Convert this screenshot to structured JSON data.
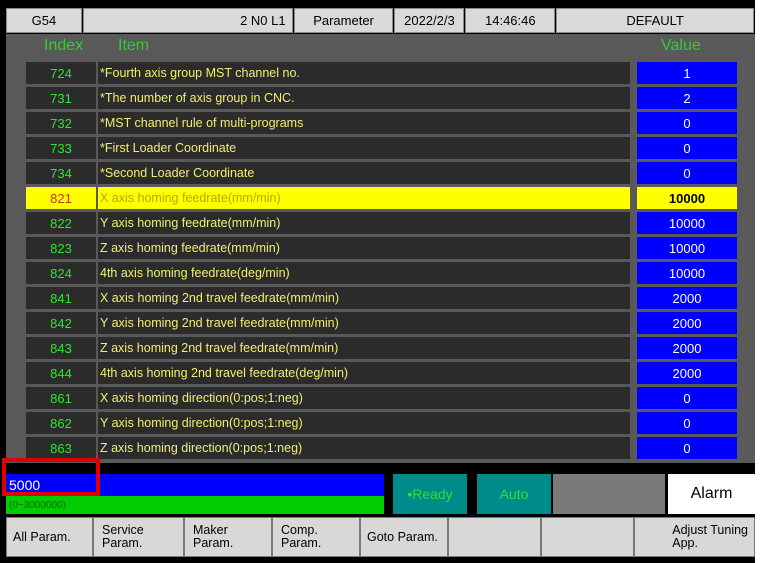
{
  "header": {
    "coord": "G54",
    "program": "2 N0 L1",
    "mode": "Parameter",
    "date": "2022/2/3",
    "time": "14:46:46",
    "profile": "DEFAULT"
  },
  "columns": {
    "index": "Index",
    "item": "Item",
    "value": "Value"
  },
  "rows": [
    {
      "index": "724",
      "item": "*Fourth axis group MST channel no.",
      "value": "1"
    },
    {
      "index": "731",
      "item": "*The number of axis group in CNC.",
      "value": "2"
    },
    {
      "index": "732",
      "item": "*MST channel rule of multi-programs",
      "value": "0"
    },
    {
      "index": "733",
      "item": "*First Loader Coordinate",
      "value": "0"
    },
    {
      "index": "734",
      "item": "*Second Loader Coordinate",
      "value": "0"
    },
    {
      "index": "821",
      "item": "X axis homing feedrate(mm/min)",
      "value": "10000",
      "selected": true
    },
    {
      "index": "822",
      "item": "Y axis homing feedrate(mm/min)",
      "value": "10000"
    },
    {
      "index": "823",
      "item": "Z axis homing feedrate(mm/min)",
      "value": "10000"
    },
    {
      "index": "824",
      "item": "4th axis homing feedrate(deg/min)",
      "value": "10000"
    },
    {
      "index": "841",
      "item": "X axis homing 2nd travel feedrate(mm/min)",
      "value": "2000"
    },
    {
      "index": "842",
      "item": "Y axis homing 2nd travel feedrate(mm/min)",
      "value": "2000"
    },
    {
      "index": "843",
      "item": "Z axis homing 2nd travel feedrate(mm/min)",
      "value": "2000"
    },
    {
      "index": "844",
      "item": "4th axis homing 2nd travel feedrate(deg/min)",
      "value": "2000"
    },
    {
      "index": "861",
      "item": "X axis homing direction(0:pos;1:neg)",
      "value": "0"
    },
    {
      "index": "862",
      "item": "Y axis homing direction(0:pos;1:neg)",
      "value": "0"
    },
    {
      "index": "863",
      "item": "Z axis homing direction(0:pos;1:neg)",
      "value": "0"
    }
  ],
  "input": {
    "value": "5000",
    "range": "(0~3000000)"
  },
  "status": {
    "ready": "•Ready",
    "auto": "Auto",
    "alarm": "Alarm"
  },
  "fkeys": [
    {
      "line1": "All Param.",
      "line2": ""
    },
    {
      "line1": "Service",
      "line2": "Param."
    },
    {
      "line1": "Maker",
      "line2": "Param."
    },
    {
      "line1": "Comp.",
      "line2": "Param."
    },
    {
      "line1": "Goto Param.",
      "line2": ""
    },
    {
      "line1": "",
      "line2": ""
    },
    {
      "line1": "",
      "line2": ""
    },
    {
      "line1": "Adjust Tuning",
      "line2": "App."
    }
  ],
  "colors": {
    "background": "#000000",
    "panel": "#595959",
    "index_text": "#2ee62e",
    "item_text": "#f0f070",
    "value_bg": "#0000ff",
    "selected_bg": "#ffff00",
    "status_teal": "#008b8b",
    "highlight": "#e00000"
  }
}
